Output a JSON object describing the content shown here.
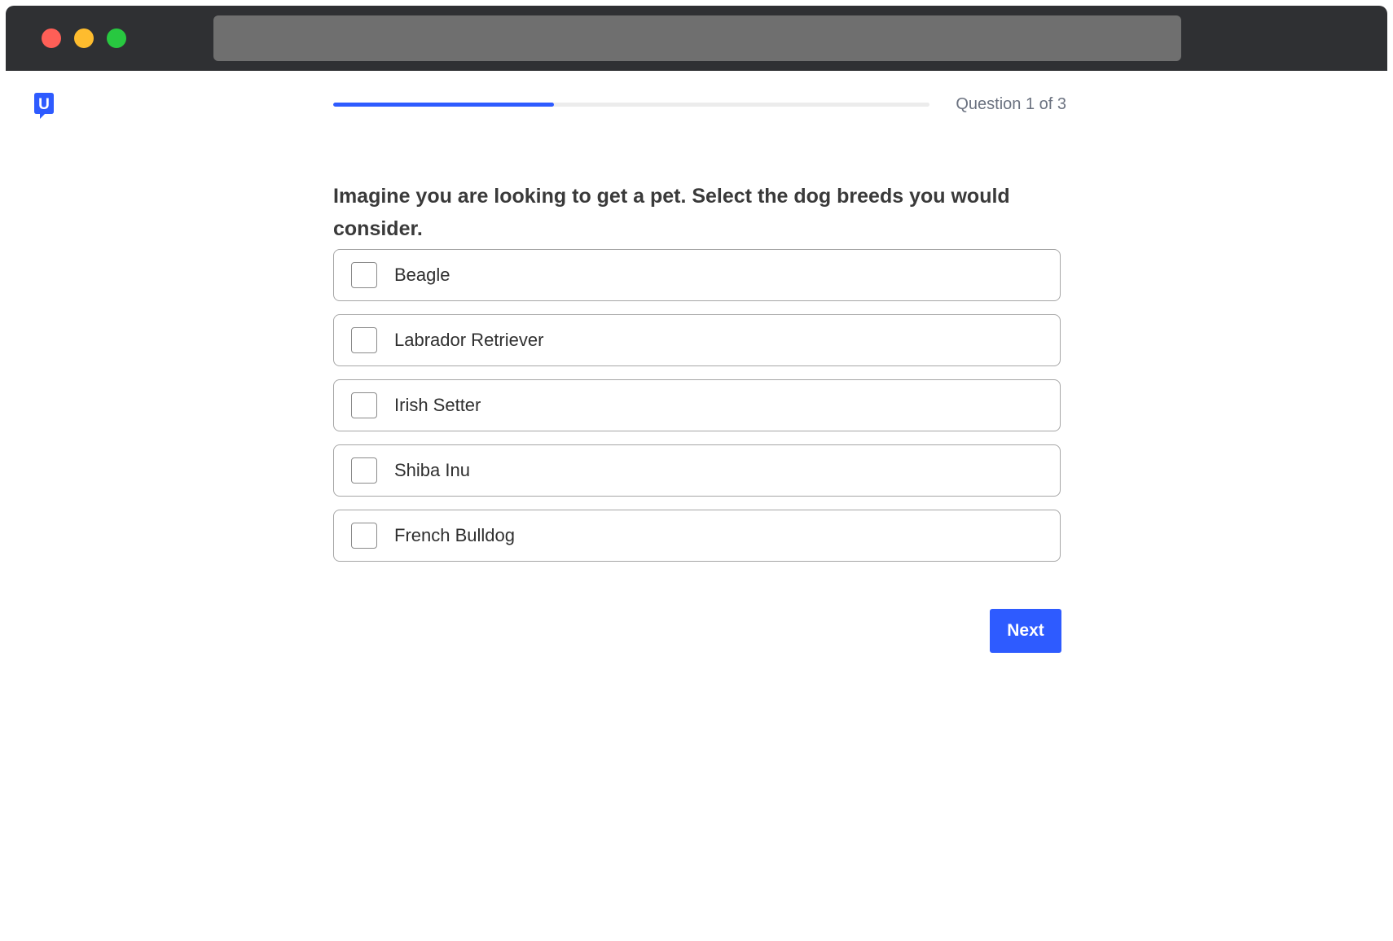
{
  "colors": {
    "titlebar": "#2f3033",
    "address_bar": "#6f6f6f",
    "traffic_red": "#ff5f57",
    "traffic_yellow": "#febc2e",
    "traffic_green": "#28c840",
    "accent": "#2e5bff",
    "progress_track": "#ececec",
    "logo": "#2e5bff"
  },
  "window": {
    "address_bar_text": ""
  },
  "header": {
    "logo_icon": "speech-bubble-u-logo-icon",
    "logo_letter": "U",
    "progress_fraction": 0.37,
    "progress_label": "Question 1 of 3"
  },
  "question": {
    "text": "Imagine you are looking to get a pet. Select the dog breeds you would consider."
  },
  "options": [
    {
      "label": "Beagle",
      "checked": false
    },
    {
      "label": "Labrador Retriever",
      "checked": false
    },
    {
      "label": "Irish Setter",
      "checked": false
    },
    {
      "label": "Shiba Inu",
      "checked": false
    },
    {
      "label": "French Bulldog",
      "checked": false
    }
  ],
  "actions": {
    "next_label": "Next"
  }
}
